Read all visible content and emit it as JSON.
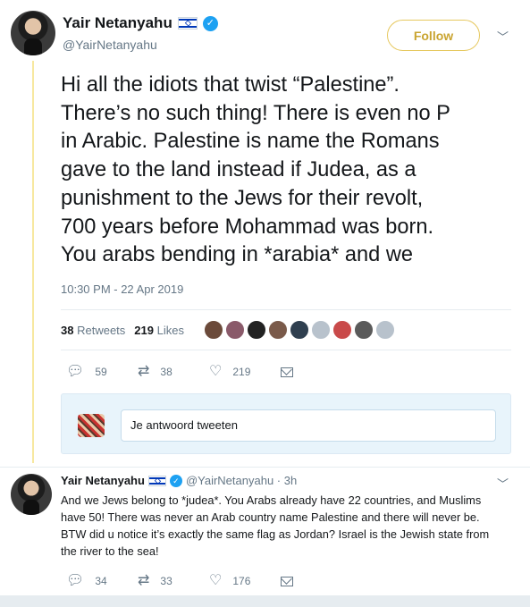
{
  "main_tweet": {
    "author_name": "Yair Netanyahu",
    "handle": "@YairNetanyahu",
    "follow_label": "Follow",
    "text": "Hi all the idiots that twist “Palestine”.\nThere’s no such thing! There is even no P\nin Arabic. Palestine is name the Romans\ngave to the land instead if Judea, as a\npunishment to the Jews for their revolt,\n700 years before Mohammad was born.\nYou arabs bending in *arabia* and we",
    "timestamp": "10:30 PM - 22 Apr 2019",
    "retweets_count": "38",
    "retweets_label": "Retweets",
    "likes_count": "219",
    "likes_label": "Likes",
    "liker_avatar_colors": [
      "#6b4a3a",
      "#8a5a6a",
      "#222222",
      "#7a5a4a",
      "#2f3f4f",
      "#b8c2cc",
      "#c94a4a",
      "#5a5a5a",
      "#b8c2cc"
    ],
    "actions": {
      "reply_count": "59",
      "retweet_count": "38",
      "like_count": "219"
    }
  },
  "reply_box": {
    "placeholder": "Je antwoord tweeten"
  },
  "reply_tweet": {
    "author_name": "Yair Netanyahu",
    "handle_time": "@YairNetanyahu · 3h",
    "text": "And we Jews belong to *judea*. You Arabs already have 22 countries, and Muslims have 50! There was never an Arab country name Palestine and there will never be. BTW did u notice it’s exactly the same flag as Jordan? Israel is the Jewish state from the river to the sea!",
    "actions": {
      "reply_count": "34",
      "retweet_count": "33",
      "like_count": "176"
    }
  },
  "colors": {
    "follow_accent": "#c9a430",
    "verified": "#1da1f2",
    "muted_text": "#657786"
  }
}
